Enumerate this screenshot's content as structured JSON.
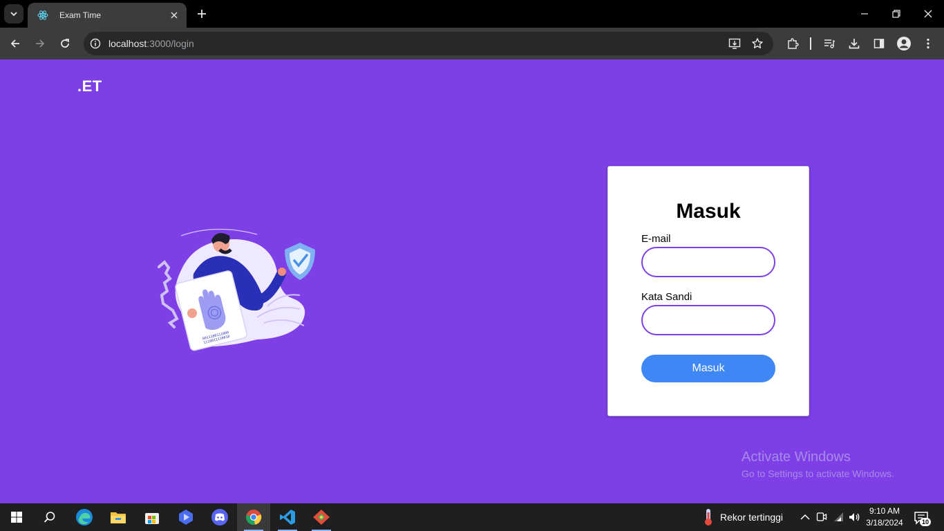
{
  "browser": {
    "tab": {
      "title": "Exam Time"
    },
    "url": {
      "host": "localhost",
      "rest": ":3000/login"
    }
  },
  "page": {
    "logo": ".ET",
    "illustration": {
      "binary_line1": "0011100111000",
      "binary_line2": "1110011110010"
    },
    "form": {
      "title": "Masuk",
      "email_label": "E-mail",
      "email_value": "",
      "password_label": "Kata Sandi",
      "password_value": "",
      "submit_label": "Masuk"
    },
    "colors": {
      "background": "#7e3fe7",
      "button": "#3f87f5",
      "input_border": "#7e3fe7"
    }
  },
  "watermark": {
    "title": "Activate Windows",
    "subtitle": "Go to Settings to activate Windows."
  },
  "taskbar": {
    "weather_text": "Rekor tertinggi",
    "time": "9:10 AM",
    "date": "3/18/2024",
    "notification_count": "10"
  }
}
